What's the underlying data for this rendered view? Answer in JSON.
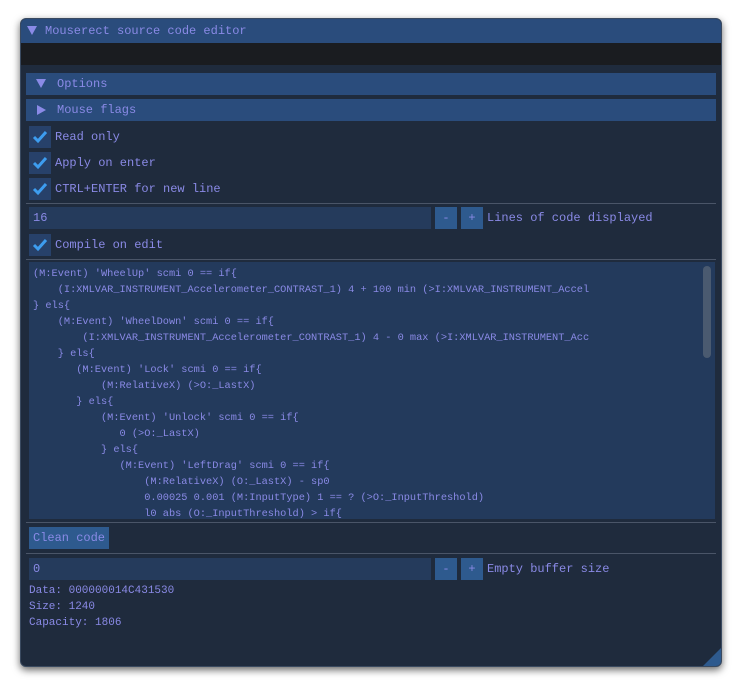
{
  "window": {
    "title": "Mouserect source code editor"
  },
  "options_header": {
    "label": "Options",
    "expanded": true
  },
  "mouse_flags_header": {
    "label": "Mouse flags",
    "expanded": false
  },
  "checkboxes": [
    {
      "label": "Read only",
      "checked": true
    },
    {
      "label": "Apply on enter",
      "checked": true
    },
    {
      "label": "CTRL+ENTER for new line",
      "checked": true
    }
  ],
  "lines_displayed": {
    "value": "16",
    "minus": "-",
    "plus": "+",
    "label": "Lines of code displayed"
  },
  "compile_on_edit": {
    "label": "Compile on edit",
    "checked": true
  },
  "code_lines": [
    "(M:Event) 'WheelUp' scmi 0 == if{",
    "    (I:XMLVAR_INSTRUMENT_Accelerometer_CONTRAST_1) 4 + 100 min (>I:XMLVAR_INSTRUMENT_Accel",
    "} els{",
    "    (M:Event) 'WheelDown' scmi 0 == if{",
    "        (I:XMLVAR_INSTRUMENT_Accelerometer_CONTRAST_1) 4 - 0 max (>I:XMLVAR_INSTRUMENT_Acc",
    "    } els{",
    "       (M:Event) 'Lock' scmi 0 == if{",
    "           (M:RelativeX) (>O:_LastX)",
    "       } els{",
    "           (M:Event) 'Unlock' scmi 0 == if{",
    "              0 (>O:_LastX)",
    "           } els{",
    "              (M:Event) 'LeftDrag' scmi 0 == if{",
    "                  (M:RelativeX) (O:_LastX) - sp0",
    "                  0.00025 0.001 (M:InputType) 1 == ? (>O:_InputThreshold)",
    "                  l0 abs (O:_InputThreshold) > if{"
  ],
  "clean_code_button": "Clean code",
  "empty_buffer": {
    "value": "0",
    "minus": "-",
    "plus": "+",
    "label": "Empty buffer size"
  },
  "info": {
    "data": "Data: 000000014C431530",
    "size": "Size: 1240",
    "capacity": "Capacity: 1806"
  },
  "colors": {
    "accent": "#2e5a8e",
    "text": "#8a8ae6",
    "background": "#1f2b3d",
    "check": "#3d9df0"
  }
}
